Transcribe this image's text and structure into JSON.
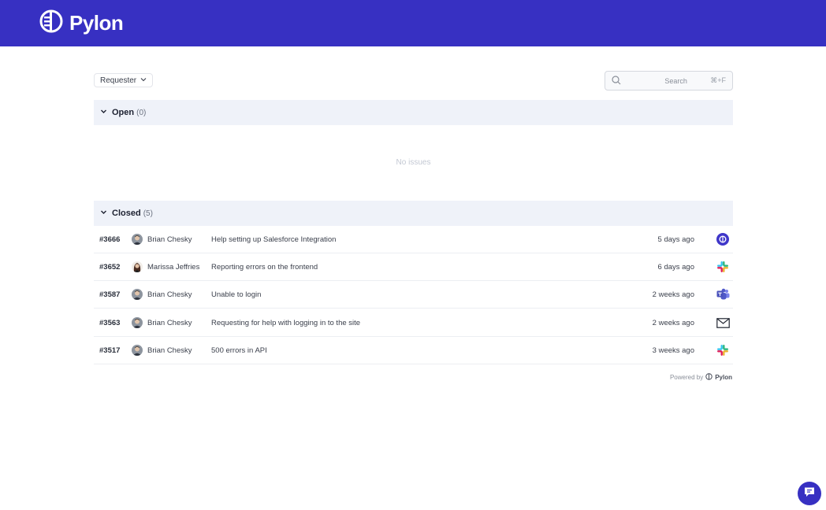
{
  "header": {
    "brand": "Pylon",
    "logo_icon": "pylon-logo-icon",
    "bg_color": "#3730c2"
  },
  "filters": {
    "requester_label": "Requester"
  },
  "search": {
    "placeholder": "Search",
    "shortcut": "⌘+F"
  },
  "open_section": {
    "title": "Open",
    "count": "(0)",
    "empty_text": "No issues"
  },
  "closed_section": {
    "title": "Closed",
    "count": "(5)",
    "rows": [
      {
        "id": "#3666",
        "requester": "Brian Chesky",
        "title": "Help setting up Salesforce Integration",
        "time": "5 days ago",
        "source": "pylon-icon"
      },
      {
        "id": "#3652",
        "requester": "Marissa Jeffries",
        "title": "Reporting errors on the frontend",
        "time": "6 days ago",
        "source": "slack-icon"
      },
      {
        "id": "#3587",
        "requester": "Brian Chesky",
        "title": "Unable to login",
        "time": "2 weeks ago",
        "source": "teams-icon"
      },
      {
        "id": "#3563",
        "requester": "Brian Chesky",
        "title": "Requesting for help with logging in to the site",
        "time": "2 weeks ago",
        "source": "email-icon"
      },
      {
        "id": "#3517",
        "requester": "Brian Chesky",
        "title": "500 errors in API",
        "time": "3 weeks ago",
        "source": "slack-icon"
      }
    ]
  },
  "footer": {
    "powered_by": "Powered by",
    "brand": "Pylon"
  },
  "chat": {
    "icon": "chat-icon"
  }
}
